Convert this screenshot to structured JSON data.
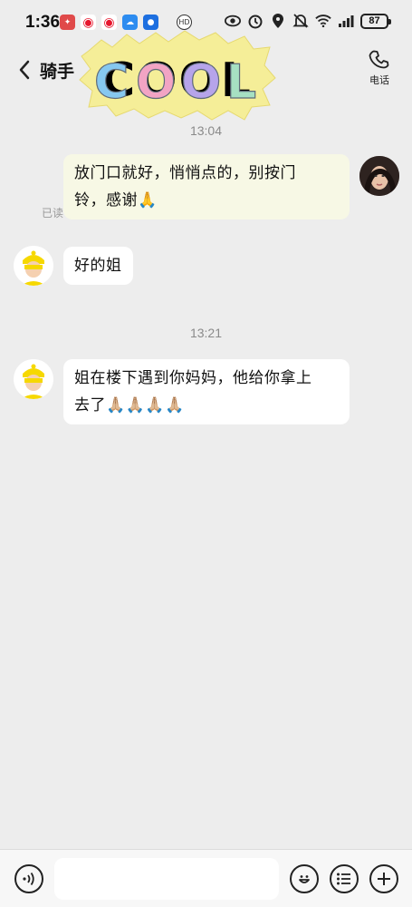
{
  "status_bar": {
    "time": "1:36",
    "battery": "87",
    "app_icons": [
      "app-badge-icon",
      "weibo-icon",
      "weibo-icon",
      "cloud-icon",
      "qq-icon",
      "hd-icon"
    ],
    "system_icons": [
      "eye-icon",
      "alarm-icon",
      "location-icon",
      "mute-icon",
      "wifi-icon",
      "signal-icon"
    ]
  },
  "nav": {
    "title": "骑手 ",
    "phone_label": "电话"
  },
  "sticker": {
    "text": "COOL"
  },
  "messages": {
    "ts1": "13:04",
    "m1": {
      "sender": "self",
      "line1": "放门口就好，悄悄点的，别按门",
      "line2": "铃，感谢🙏",
      "read": "已读"
    },
    "m2": {
      "sender": "rider",
      "text": "好的姐"
    },
    "ts2": "13:21",
    "m3": {
      "sender": "rider",
      "line1": "姐在楼下遇到你妈妈，他给你拿上",
      "line2": "去了🙏🏼🙏🏼🙏🏼🙏🏼"
    }
  },
  "input_bar": {
    "placeholder": ""
  }
}
